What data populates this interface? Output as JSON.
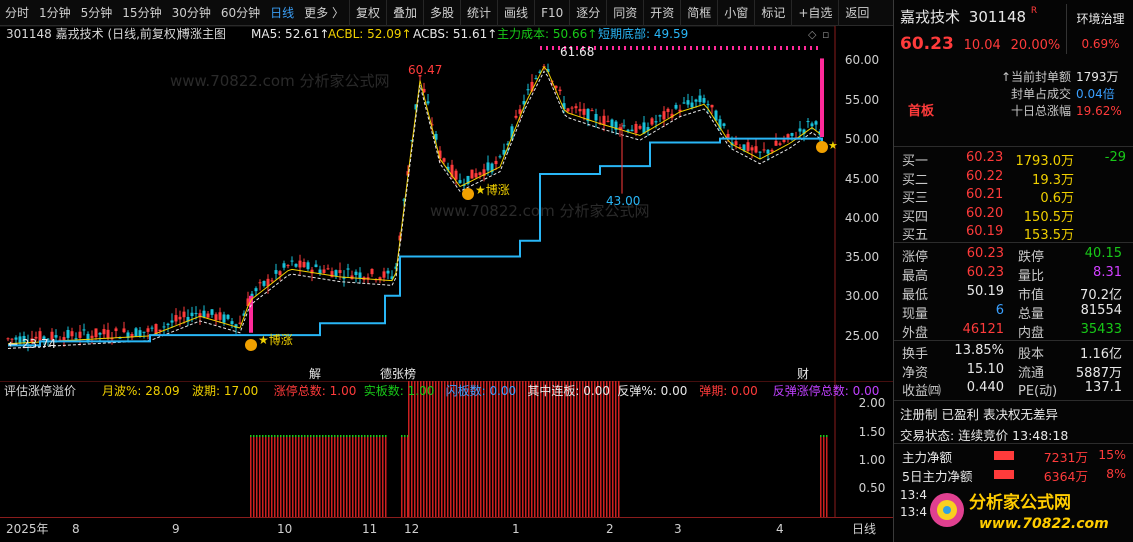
{
  "toolbar": {
    "periods": [
      "分时",
      "1分钟",
      "5分钟",
      "15分钟",
      "30分钟",
      "60分钟",
      "日线",
      "更多 〉"
    ],
    "active_period": "日线",
    "actions": [
      "复权",
      "叠加",
      "多股",
      "统计",
      "画线",
      "F10",
      "逐分",
      "同资",
      "开资",
      "简框",
      "小窗",
      "标记",
      "+自选",
      "返回"
    ]
  },
  "main_chart": {
    "title": "301148 嘉戎技术 (日线,前复权)",
    "formula": "博涨主图",
    "ma5_label": "MA5: 52.61↑",
    "acbl_label": "ACBL: 52.09↑",
    "acbs_label": "ACBS: 51.61↑",
    "cost_label": "主力成本: 50.66↑",
    "bottom_label": "短期底部: 49.59",
    "high_label": "61.68",
    "peak_label": "60.47",
    "low_label": "43.00",
    "start_label": "← 23.74",
    "signal_label": "★博涨",
    "events": [
      "解",
      "德张榜",
      "财"
    ],
    "y_ticks": [
      "60.00",
      "55.00",
      "50.00",
      "45.00",
      "40.00",
      "35.00",
      "30.00",
      "25.00"
    ],
    "watermark": "www.70822.com 分析家公式网"
  },
  "sub_chart": {
    "title": "评估涨停溢价",
    "labels": [
      {
        "text": "月波%: 28.09",
        "color": "#f0d000"
      },
      {
        "text": "波期: 17.00",
        "color": "#f0d000"
      },
      {
        "text": "涨停总数: 1.00",
        "color": "#ff3b3b"
      },
      {
        "text": "实板数: 1.00",
        "color": "#18c918"
      },
      {
        "text": "闪板数: 0.00",
        "color": "#3aa0ff"
      },
      {
        "text": "其中连板: 0.00",
        "color": "#e8e8e8"
      },
      {
        "text": "反弹%: 0.00",
        "color": "#e8e8e8"
      },
      {
        "text": "弹期: 0.00",
        "color": "#ff3b3b"
      },
      {
        "text": "反弹涨停总数: 0.00",
        "color": "#c040ff"
      }
    ],
    "y_ticks": [
      "2.00",
      "1.50",
      "1.00",
      "0.50"
    ]
  },
  "time_axis": {
    "labels": [
      "2025年",
      "8",
      "9",
      "10",
      "11",
      "12",
      "1",
      "2",
      "3",
      "4"
    ],
    "period_label": "日线"
  },
  "quote": {
    "name": "嘉戎技术",
    "code": "301148",
    "badge": "R",
    "tag": "环境治理",
    "price": "60.23",
    "change": "10.04",
    "change_pct": "20.00%",
    "tag_pct": "0.69%",
    "board_label": "首板",
    "seal_amount_label": "↑当前封单额",
    "seal_amount": "1793万",
    "seal_ratio_label": "封单占成交",
    "seal_ratio": "0.04倍",
    "ten_day_label": "十日总涨幅",
    "ten_day": "19.62%"
  },
  "orderbook": {
    "bids": [
      {
        "label": "买一",
        "price": "60.23",
        "vol": "1793.0万",
        "delta": "-29"
      },
      {
        "label": "买二",
        "price": "60.22",
        "vol": "19.3万",
        "delta": ""
      },
      {
        "label": "买三",
        "price": "60.21",
        "vol": "0.6万",
        "delta": ""
      },
      {
        "label": "买四",
        "price": "60.20",
        "vol": "150.5万",
        "delta": ""
      },
      {
        "label": "买五",
        "price": "60.19",
        "vol": "153.5万",
        "delta": ""
      }
    ]
  },
  "stats": [
    {
      "l1": "涨停",
      "v1": "60.23",
      "c1": "#ff3b3b",
      "l2": "跌停",
      "v2": "40.15",
      "c2": "#18c918"
    },
    {
      "l1": "最高",
      "v1": "60.23",
      "c1": "#ff3b3b",
      "l2": "量比",
      "v2": "8.31",
      "c2": "#d040ff"
    },
    {
      "l1": "最低",
      "v1": "50.19",
      "c1": "#e8e8e8",
      "l2": "市值",
      "v2": "70.2亿",
      "c2": "#e8e8e8"
    },
    {
      "l1": "现量",
      "v1": "6",
      "c1": "#3aa0ff",
      "l2": "总量",
      "v2": "81554",
      "c2": "#e8e8e8"
    },
    {
      "l1": "外盘",
      "v1": "46121",
      "c1": "#ff3b3b",
      "l2": "内盘",
      "v2": "35433",
      "c2": "#18c918"
    }
  ],
  "stats2": [
    {
      "l1": "换手",
      "v1": "13.85%",
      "l2": "股本",
      "v2": "1.16亿"
    },
    {
      "l1": "净资",
      "v1": "15.10",
      "l2": "流通",
      "v2": "5887万"
    },
    {
      "l1": "收益㈣",
      "v1": "0.440",
      "l2": "PE(动)",
      "v2": "137.1"
    }
  ],
  "info": {
    "line1": "注册制 已盈利 表决权无差异",
    "status_label": "交易状态: 连续竞价 13:48:18"
  },
  "flows": [
    {
      "label": "主力净额",
      "value": "7231万",
      "pct": "15%"
    },
    {
      "label": "5日主力净额",
      "value": "6364万",
      "pct": "8%"
    }
  ],
  "ticks": [
    "13:4",
    "13:4"
  ],
  "logo": {
    "title": "分析家公式网",
    "url": "www.70822.com"
  },
  "colors": {
    "up": "#ff3b3b",
    "down": "#18c918",
    "support": "#29b6f6",
    "limit": "#ff2a9a",
    "ma": "#f0d000"
  }
}
